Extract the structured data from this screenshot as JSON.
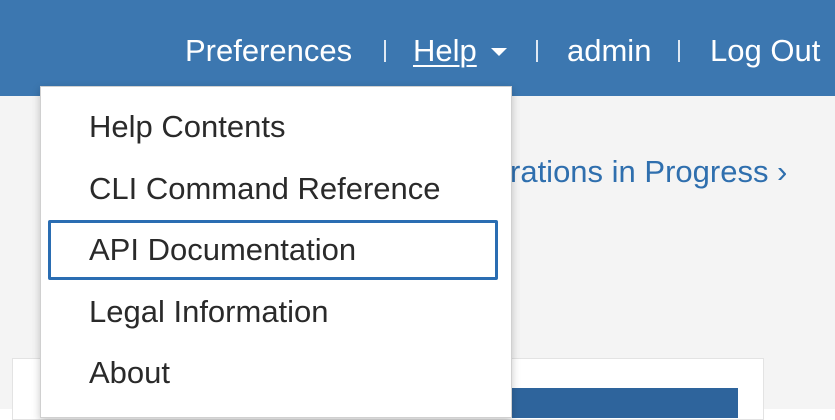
{
  "header": {
    "nav": {
      "preferences": "Preferences",
      "separator": "|",
      "help": "Help",
      "user": "admin",
      "logout": "Log Out"
    }
  },
  "main": {
    "operations_link": "rations in Progress ›"
  },
  "help_menu": {
    "items": [
      {
        "label": "Help Contents"
      },
      {
        "label": "CLI Command Reference"
      },
      {
        "label": "API Documentation"
      },
      {
        "label": "Legal Information"
      },
      {
        "label": "About"
      }
    ],
    "highlighted_item": "API Documentation"
  },
  "colors": {
    "header_bg": "#3c77b0",
    "link": "#2f6fae",
    "highlight_border": "#2a6db2"
  },
  "icons": {
    "help_dropdown": "caret-down-icon"
  }
}
